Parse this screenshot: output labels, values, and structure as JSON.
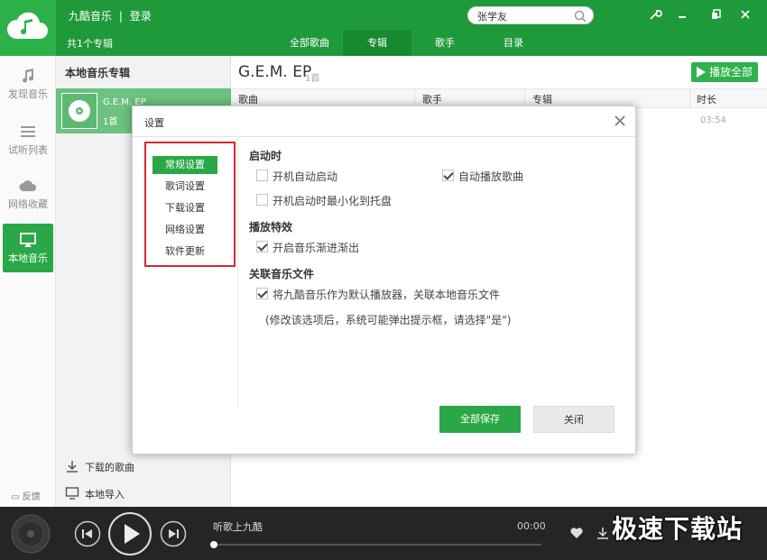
{
  "app": {
    "brand": "九酷音乐",
    "separator": "|",
    "login": "登录",
    "search_value": "张学友"
  },
  "subbar": {
    "album_count": "共1个专辑",
    "tabs": [
      {
        "label": "全部歌曲",
        "active": false
      },
      {
        "label": "专辑",
        "active": true
      },
      {
        "label": "歌手",
        "active": false
      },
      {
        "label": "目录",
        "active": false
      }
    ]
  },
  "leftnav": {
    "items": [
      {
        "label": "发现音乐",
        "icon": "music-note-icon",
        "active": false
      },
      {
        "label": "试听列表",
        "icon": "list-icon",
        "active": false
      },
      {
        "label": "网络收藏",
        "icon": "cloud-icon",
        "active": false
      },
      {
        "label": "本地音乐",
        "icon": "monitor-icon",
        "active": true
      }
    ],
    "feedback": "反馈"
  },
  "album_panel": {
    "title": "本地音乐专辑",
    "album": {
      "name": "G.E.M. EP",
      "count": "1首"
    },
    "downloaded": "下载的歌曲",
    "local_import": "本地导入"
  },
  "main": {
    "title": "G.E.M. EP",
    "count": "1首",
    "play_all": "播放全部",
    "columns": [
      "歌曲",
      "歌手",
      "专辑",
      "时长"
    ],
    "row_duration": "03:54"
  },
  "dialog": {
    "title": "设置",
    "categories": [
      {
        "label": "常规设置",
        "active": true
      },
      {
        "label": "歌词设置",
        "active": false
      },
      {
        "label": "下载设置",
        "active": false
      },
      {
        "label": "网络设置",
        "active": false
      },
      {
        "label": "软件更新",
        "active": false
      }
    ],
    "sections": {
      "startup": "启动时",
      "effects": "播放特效",
      "association": "关联音乐文件"
    },
    "options": {
      "auto_start": {
        "label": "开机自动启动",
        "checked": false
      },
      "auto_play": {
        "label": "自动播放歌曲",
        "checked": true
      },
      "minimize_tray": {
        "label": "开机启动时最小化到托盘",
        "checked": false
      },
      "fade": {
        "label": "开启音乐渐进渐出",
        "checked": true
      },
      "default_player": {
        "label": "将九酷音乐作为默认播放器，关联本地音乐文件",
        "checked": true
      }
    },
    "note": "(修改该选项后，系统可能弹出提示框，请选择\"是\")",
    "save_button": "全部保存",
    "close_button": "关闭"
  },
  "player": {
    "now_playing": "听歌上九酷",
    "time": "00:00",
    "progress": 0
  },
  "watermark": "极速下载站",
  "colors": {
    "accent": "#2aa847",
    "topbar": "#1f9a3a",
    "highlight_border": "#d9282f",
    "player_bg": "#252525"
  }
}
